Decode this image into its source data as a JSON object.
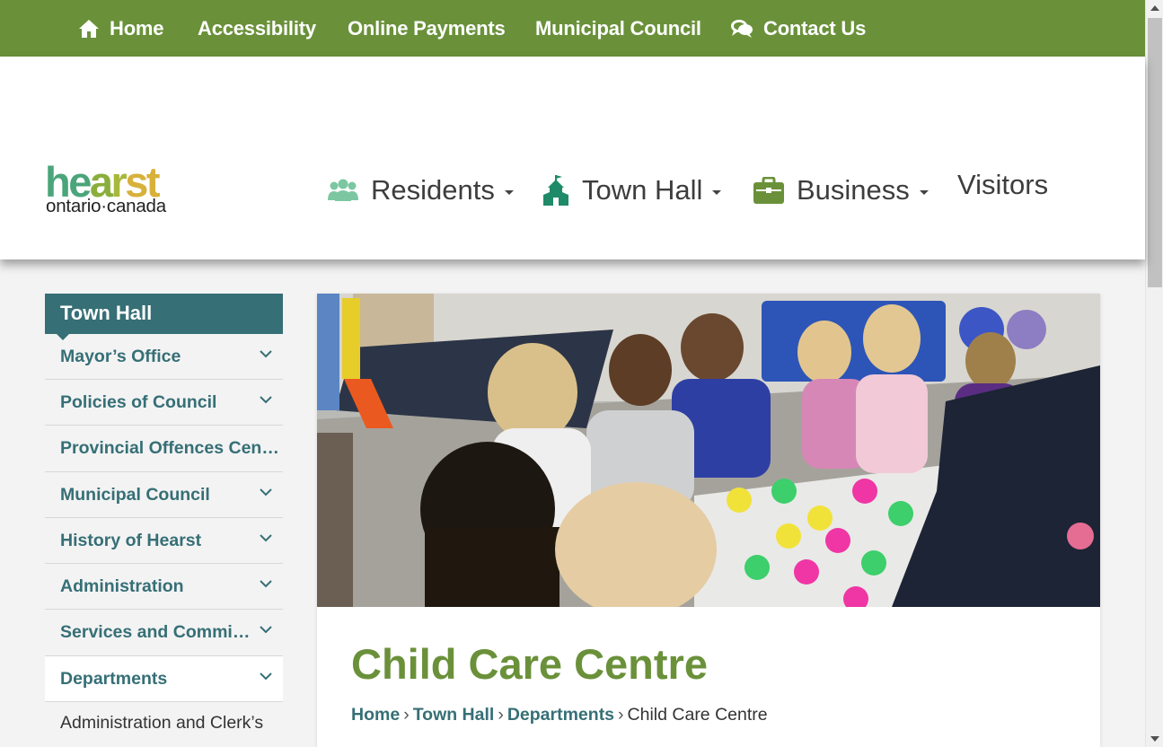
{
  "topbar": {
    "items": [
      {
        "label": "Home",
        "icon": "home-icon"
      },
      {
        "label": "Accessibility"
      },
      {
        "label": "Online Payments"
      },
      {
        "label": "Municipal Council"
      },
      {
        "label": "Contact Us",
        "icon": "chat-bubbles-icon"
      }
    ]
  },
  "logo": {
    "word": [
      "he",
      "a",
      "r",
      "st"
    ],
    "sub": "ontario·canada"
  },
  "nav": {
    "items": [
      {
        "label": "Residents",
        "icon": "people-icon",
        "icon_color": "#7cc7a1"
      },
      {
        "label": "Town Hall",
        "icon": "town-hall-icon",
        "icon_color": "#1f8a68"
      },
      {
        "label": "Business",
        "icon": "briefcase-icon",
        "icon_color": "#6a913a"
      },
      {
        "label": "Visitors"
      }
    ]
  },
  "sidebar": {
    "title": "Town Hall",
    "items": [
      {
        "label": "Mayor’s Office"
      },
      {
        "label": "Policies of Council"
      },
      {
        "label": "Provincial Offences Centre"
      },
      {
        "label": "Municipal Council"
      },
      {
        "label": "History of Hearst"
      },
      {
        "label": "Administration"
      },
      {
        "label": "Services and Committees"
      },
      {
        "label": "Departments"
      }
    ],
    "sub_item": "Administration and Clerk’s"
  },
  "content": {
    "hero_alt": "children-sitting-on-alphabet-mat-photo",
    "title": "Child Care Centre",
    "breadcrumb": [
      "Home",
      "Town Hall",
      "Departments"
    ],
    "breadcrumb_current": "Child Care Centre",
    "breadcrumb_sep": "›"
  },
  "colors": {
    "topbar_bg": "#6a913a",
    "sidebar_title_bg": "#366f76",
    "link": "#366f76",
    "page_title": "#6a913a"
  }
}
